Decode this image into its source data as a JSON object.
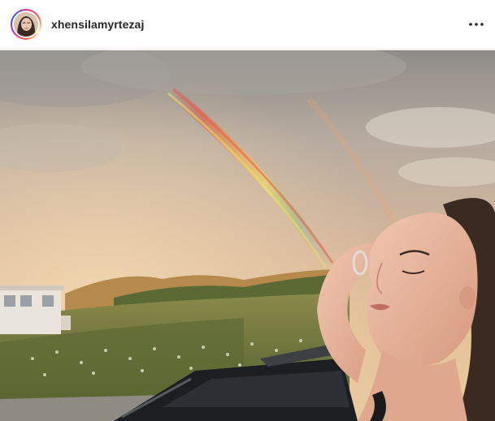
{
  "post": {
    "username": "xhensilamyrtezaj",
    "avatar_icon": "profile-photo",
    "more_icon": "more-options-icon",
    "photo_description_icon": "rainbow-photo"
  },
  "colors": {
    "username": "#262626",
    "story_ring_start": "#d6249f",
    "story_ring_end": "#fd5949",
    "border": "#efefef"
  }
}
